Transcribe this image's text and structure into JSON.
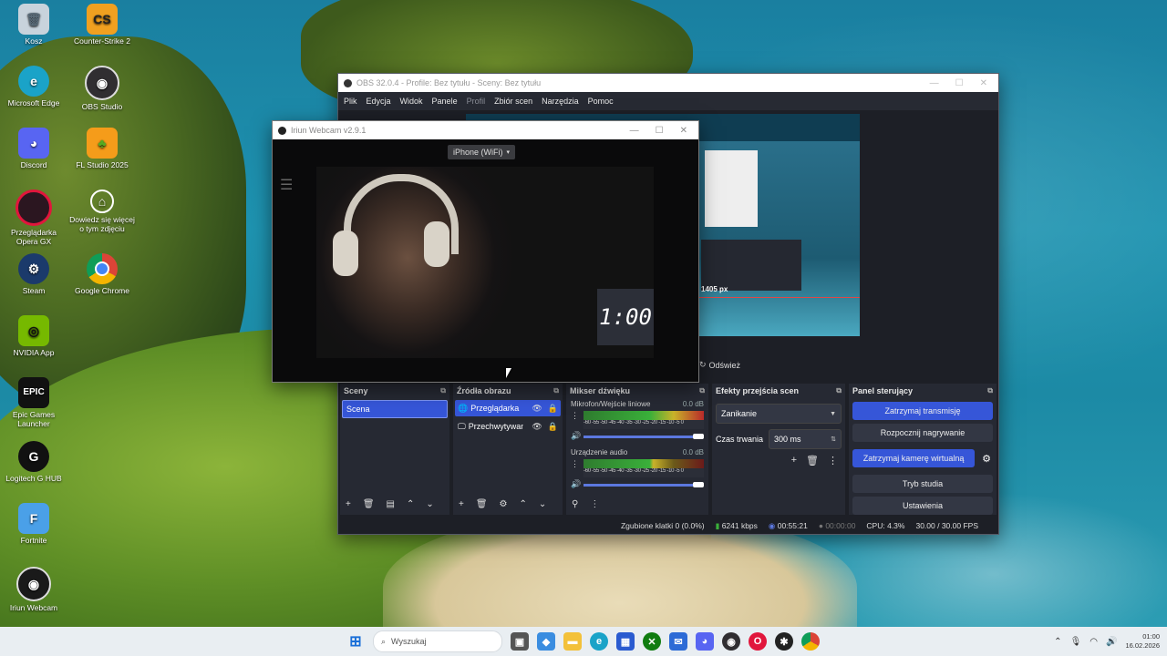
{
  "desktop_icons": [
    {
      "label": "Kosz",
      "icon": "recycle-bin-icon"
    },
    {
      "label": "Counter-Strike 2",
      "icon": "counter-strike-icon"
    },
    {
      "label": "Microsoft Edge",
      "icon": "edge-icon"
    },
    {
      "label": "OBS Studio",
      "icon": "obs-icon"
    },
    {
      "label": "Discord",
      "icon": "discord-icon"
    },
    {
      "label": "FL Studio 2025",
      "icon": "fl-studio-icon"
    },
    {
      "label": "Przeglądarka Opera GX",
      "icon": "opera-gx-icon"
    },
    {
      "label": "Dowiedz się więcej o tym zdjęciu",
      "icon": "spotlight-icon"
    },
    {
      "label": "Steam",
      "icon": "steam-icon"
    },
    {
      "label": "Google Chrome",
      "icon": "chrome-icon"
    },
    {
      "label": "NVIDIA App",
      "icon": "nvidia-icon"
    },
    {
      "label": "Epic Games Launcher",
      "icon": "epic-games-icon"
    },
    {
      "label": "Logitech G HUB",
      "icon": "logitech-icon"
    },
    {
      "label": "Fortnite",
      "icon": "fortnite-icon"
    },
    {
      "label": "Iriun Webcam",
      "icon": "iriun-icon"
    }
  ],
  "obs": {
    "title": "OBS 32.0.4 - Profile: Bez tytułu - Sceny: Bez tytułu",
    "menu": [
      "Plik",
      "Edycja",
      "Widok",
      "Panele",
      "Profil",
      "Zbiór scen",
      "Narzędzia",
      "Pomoc"
    ],
    "preview_label": "1405 px",
    "refresh_label": "Odśwież",
    "scenes": {
      "title": "Sceny",
      "items": [
        "Scena"
      ]
    },
    "sources": {
      "title": "Źródła obrazu",
      "items": [
        "Przeglądarka",
        "Przechwytywanie"
      ]
    },
    "mixer": {
      "title": "Mikser dźwięku",
      "channels": [
        {
          "name": "Mikrofon/Wejście liniowe",
          "db": "0.0 dB"
        },
        {
          "name": "Urządzenie audio",
          "db": "0.0 dB"
        }
      ],
      "scale": "-60 -55 -50 -45 -40 -35 -30 -25 -20 -15 -10 -5 0"
    },
    "transitions": {
      "title": "Efekty przejścia scen",
      "effect": "Zanikanie",
      "duration_label": "Czas trwania",
      "duration": "300 ms"
    },
    "controls": {
      "title": "Panel sterujący",
      "buttons": [
        "Zatrzymaj transmisję",
        "Rozpocznij nagrywanie",
        "Zatrzymaj kamerę wirtualną",
        "Tryb studia",
        "Ustawienia"
      ]
    },
    "status": {
      "dropped": "Zgubione klatki 0 (0.0%)",
      "bitrate": "6241 kbps",
      "stream_time": "00:55:21",
      "rec_time": "00:00:00",
      "cpu": "CPU: 4.3%",
      "fps": "30.00 / 30.00 FPS"
    }
  },
  "iriun": {
    "title": "Iriun Webcam v2.9.1",
    "device": "iPhone (WiFi)",
    "clock": "1:00"
  },
  "taskbar": {
    "search_placeholder": "Wyszukaj",
    "time": "01:00",
    "date": "16.02.2026"
  }
}
